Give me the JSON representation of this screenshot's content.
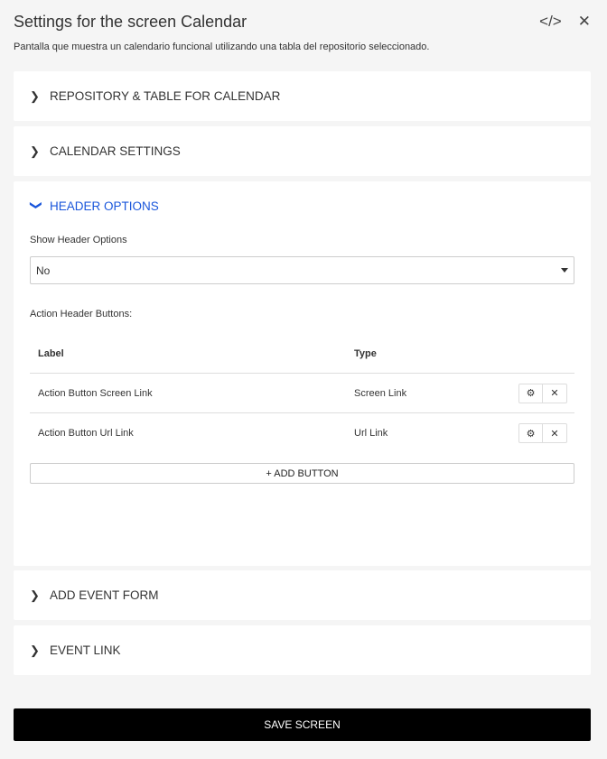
{
  "header": {
    "title": "Settings for the screen Calendar",
    "subtitle": "Pantalla que muestra un calendario funcional utilizando una tabla del repositorio seleccionado.",
    "code_icon": "</>",
    "close_icon": "✕"
  },
  "sections": [
    {
      "label": "REPOSITORY & TABLE FOR CALENDAR",
      "expanded": false
    },
    {
      "label": "CALENDAR SETTINGS",
      "expanded": false
    },
    {
      "label": "HEADER OPTIONS",
      "expanded": true
    },
    {
      "label": "ADD EVENT FORM",
      "expanded": false
    },
    {
      "label": "EVENT LINK",
      "expanded": false
    }
  ],
  "header_options": {
    "show_label": "Show Header Options",
    "show_value": "No",
    "buttons_label": "Action Header Buttons:",
    "columns": [
      "Label",
      "Type"
    ],
    "rows": [
      {
        "label": "Action Button Screen Link",
        "type": "Screen Link"
      },
      {
        "label": "Action Button Url Link",
        "type": "Url Link"
      }
    ],
    "add_label": "+ ADD BUTTON"
  },
  "save_label": "SAVE SCREEN",
  "colors": {
    "accent": "#1a56db",
    "save_bg": "#000000"
  }
}
